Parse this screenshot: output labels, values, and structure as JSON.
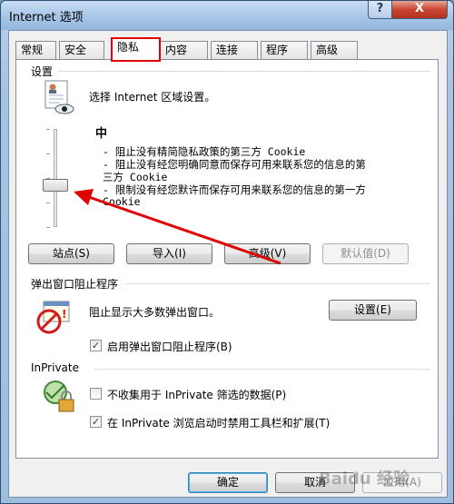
{
  "window": {
    "title": "Internet 选项",
    "help_label": "?",
    "close_label": "X"
  },
  "tabs": [
    {
      "label": "常规"
    },
    {
      "label": "安全"
    },
    {
      "label": "隐私",
      "active": true
    },
    {
      "label": "内容"
    },
    {
      "label": "连接"
    },
    {
      "label": "程序"
    },
    {
      "label": "高级"
    }
  ],
  "settings": {
    "group_title": "设置",
    "instruction": "选择 Internet 区域设置。",
    "level_title": "中",
    "level_lines": [
      "- 阻止没有精简隐私政策的第三方 Cookie",
      "- 阻止没有经您明确同意而保存可用来联系您的信息的第",
      "三方 Cookie",
      "- 限制没有经您默许而保存可用来联系您的信息的第一方",
      "Cookie"
    ],
    "slider_level_fraction": 0.5,
    "buttons": {
      "sites": "站点(S)",
      "import": "导入(I)",
      "advanced": "高级(V)",
      "default": "默认值(D)"
    }
  },
  "popup": {
    "group_title": "弹出窗口阻止程序",
    "description": "阻止显示大多数弹出窗口。",
    "settings_button": "设置(E)",
    "enable_label": "启用弹出窗口阻止程序(B)",
    "enable_checked": true
  },
  "inprivate": {
    "group_title": "InPrivate",
    "no_collect_label": "不收集用于 InPrivate 筛选的数据(P)",
    "no_collect_checked": false,
    "disable_toolbars_label": "在 InPrivate 浏览启动时禁用工具栏和扩展(T)",
    "disable_toolbars_checked": true
  },
  "footer": {
    "ok": "确定",
    "cancel": "取消",
    "apply": "应用(A)"
  },
  "watermark": "Baidu 经验",
  "colors": {
    "highlight_box": "#e00000",
    "arrow": "#e00000"
  }
}
